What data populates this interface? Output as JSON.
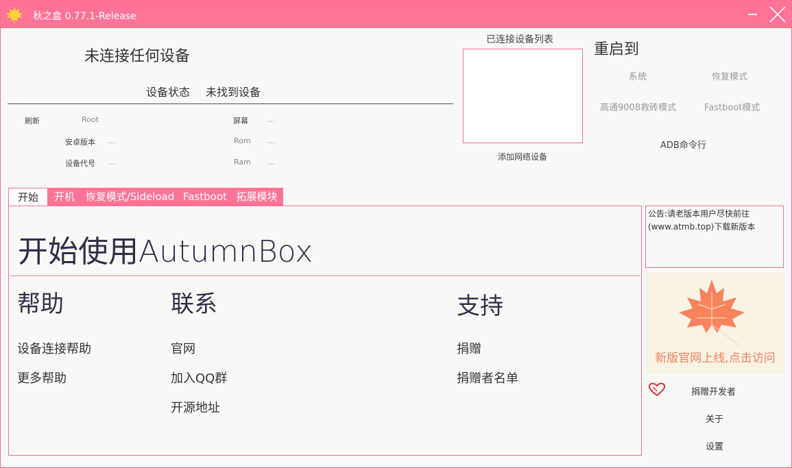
{
  "window": {
    "title": "秋之盒  0.77.1-Release"
  },
  "device": {
    "title": "未连接任何设备",
    "status_label": "设备状态",
    "status_value": "未找到设备",
    "refresh": "刷新",
    "root_label": "Root",
    "android_label": "安卓版本",
    "android_value": "...",
    "codename_label": "设备代号",
    "codename_value": "...",
    "screen_label": "屏幕",
    "screen_value": "...",
    "rom_label": "Rom",
    "rom_value": "...",
    "ram_label": "Ram",
    "ram_value": "..."
  },
  "device_list": {
    "title": "已连接设备列表",
    "add_network": "添加网络设备"
  },
  "reboot": {
    "title": "重启到",
    "system": "系统",
    "recovery": "恢复模式",
    "edl": "高通9008救砖模式",
    "fastboot": "Fastboot模式",
    "adb_cmd": "ADB命令行"
  },
  "tabs": [
    "开始",
    "开机",
    "恢复模式/Sideload",
    "Fastboot",
    "拓展模块"
  ],
  "start": {
    "title": "开始使用AutumnBox",
    "help": {
      "title": "帮助",
      "links": [
        "设备连接帮助",
        "更多帮助"
      ]
    },
    "contact": {
      "title": "联系",
      "links": [
        "官网",
        "加入QQ群",
        "开源地址"
      ]
    },
    "support": {
      "title": "支持",
      "links": [
        "捐赠",
        "捐赠者名单"
      ]
    }
  },
  "notice": "公告:请老版本用户尽快前往(www.atmb.top)下载新版本",
  "banner": {
    "text": "新版官网上线,点击访问"
  },
  "sidebar": {
    "donate": "捐赠开发者",
    "about": "关于",
    "settings": "设置"
  },
  "colors": {
    "accent": "#ff7496",
    "border": "#f06f97",
    "leaf": "#f7845c"
  }
}
